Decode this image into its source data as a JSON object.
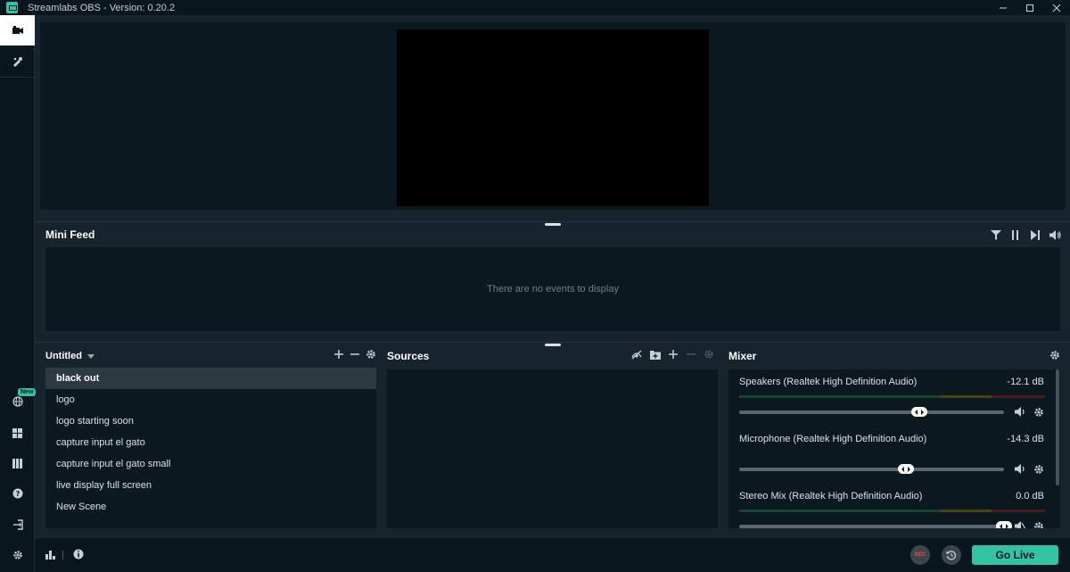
{
  "window": {
    "title": "Streamlabs OBS - Version: 0.20.2",
    "controls": [
      "minimize",
      "maximize",
      "close"
    ]
  },
  "leftnav": {
    "top_items": [
      {
        "name": "studio-mode-icon",
        "active": true
      },
      {
        "name": "themes-icon",
        "active": false
      }
    ],
    "bottom_items": [
      {
        "name": "globe-icon",
        "badge": "New"
      },
      {
        "name": "layout-icon"
      },
      {
        "name": "library-icon"
      },
      {
        "name": "help-icon"
      },
      {
        "name": "login-icon"
      },
      {
        "name": "settings-icon"
      }
    ]
  },
  "minifeed": {
    "title": "Mini Feed",
    "empty_text": "There are no events to display",
    "controls": [
      "filter-icon",
      "pause-icon",
      "skip-icon",
      "volume-icon"
    ]
  },
  "scenes": {
    "title": "Untitled",
    "items": [
      "black out",
      "logo",
      "logo starting soon",
      "capture input el gato",
      "capture input el gato small",
      "live display full screen",
      "New Scene"
    ],
    "selected_index": 0
  },
  "sources": {
    "title": "Sources",
    "items": []
  },
  "mixer": {
    "title": "Mixer",
    "items": [
      {
        "name": "Speakers (Realtek High Definition Audio)",
        "db": "-12.1 dB",
        "level": 0.68
      },
      {
        "name": "Microphone (Realtek High Definition Audio)",
        "db": "-14.3 dB",
        "level": 0.63
      },
      {
        "name": "Stereo Mix (Realtek High Definition Audio)",
        "db": "0.0 dB",
        "level": 1.0
      }
    ]
  },
  "footer": {
    "rec_label": "REC",
    "go_live_label": "Go Live"
  },
  "colors": {
    "accent": "#31c3a2",
    "background": "#17242d",
    "panel": "#0b1820",
    "rec": "#ef4a4a"
  }
}
